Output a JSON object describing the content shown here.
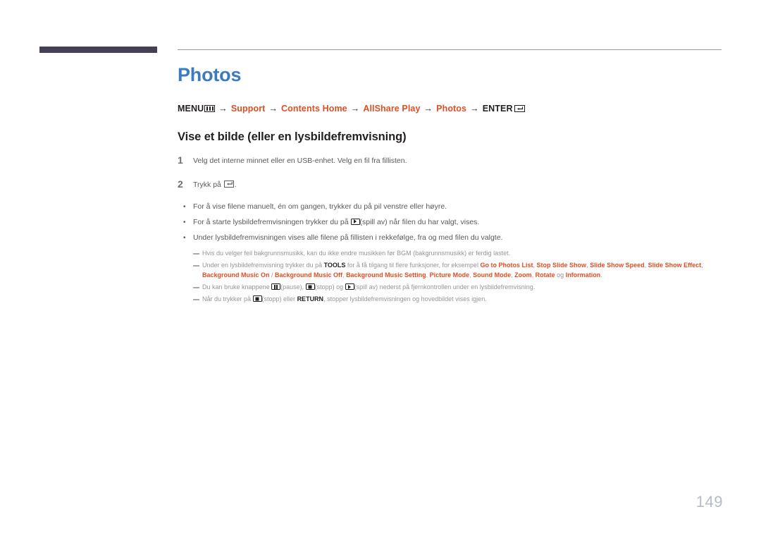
{
  "header": {
    "accent_bar_color": "#463e54",
    "rule_color": "#9a9a9a"
  },
  "doc": {
    "title": "Photos",
    "title_color": "#3b7cc1",
    "accent_color": "#de4f23"
  },
  "breadcrumb": {
    "arrow": "→",
    "items": [
      {
        "label": "MENU",
        "style": "plain",
        "icon": "menu-bars-icon"
      },
      {
        "label": "Support",
        "style": "accent",
        "icon": ""
      },
      {
        "label": "Contents Home",
        "style": "accent",
        "icon": ""
      },
      {
        "label": "AllShare Play",
        "style": "accent",
        "icon": ""
      },
      {
        "label": "Photos",
        "style": "accent",
        "icon": ""
      },
      {
        "label": "ENTER",
        "style": "plain",
        "icon": "enter-key-icon"
      }
    ]
  },
  "section": {
    "heading": "Vise et bilde (eller en lysbildefremvisning)"
  },
  "steps": [
    {
      "number": "1",
      "text": "Velg det interne minnet eller en USB-enhet. Velg en fil fra fillisten."
    },
    {
      "number": "2",
      "text_before": "Trykk på ",
      "icon": "enter-key-icon",
      "text_after": "."
    }
  ],
  "bullets": [
    {
      "marker": "•",
      "parts": [
        {
          "t": "text",
          "v": "For å vise filene manuelt, én om gangen, trykker du på pil venstre eller høyre."
        }
      ]
    },
    {
      "marker": "•",
      "parts": [
        {
          "t": "text",
          "v": "For å starte lysbildefremvisningen trykker du på "
        },
        {
          "t": "icon",
          "v": "play-key-icon"
        },
        {
          "t": "text",
          "v": "(spill av) når filen du har valgt, vises."
        }
      ]
    },
    {
      "marker": "•",
      "parts": [
        {
          "t": "text",
          "v": "Under lysbildefremvisningen vises alle filene på fillisten i rekkefølge, fra og med filen du valgte."
        }
      ]
    }
  ],
  "notes": [
    {
      "parts": [
        {
          "t": "text",
          "v": "Hvis du velger feil bakgrunnsmusikk, kan du ikke endre musikken før BGM (bakgrunnsmusikk) er ferdig lastet."
        }
      ]
    },
    {
      "parts": [
        {
          "t": "text",
          "v": "Under en lysbildefremvisning trykker du på "
        },
        {
          "t": "bold",
          "v": "TOOLS"
        },
        {
          "t": "text",
          "v": " for å få tilgang til flere funksjoner, for eksempel "
        },
        {
          "t": "accent",
          "v": "Go to Photos List"
        },
        {
          "t": "text",
          "v": ", "
        },
        {
          "t": "accent",
          "v": "Stop Slide Show"
        },
        {
          "t": "text",
          "v": ", "
        },
        {
          "t": "accent",
          "v": "Slide Show Speed"
        },
        {
          "t": "text",
          "v": ", "
        },
        {
          "t": "accent",
          "v": "Slide Show Effect"
        },
        {
          "t": "text",
          "v": ", "
        },
        {
          "t": "accent",
          "v": "Background Music On"
        },
        {
          "t": "text",
          "v": " / "
        },
        {
          "t": "accent",
          "v": "Background Music Off"
        },
        {
          "t": "text",
          "v": ", "
        },
        {
          "t": "accent",
          "v": "Background Music Setting"
        },
        {
          "t": "text",
          "v": ", "
        },
        {
          "t": "accent",
          "v": "Picture Mode"
        },
        {
          "t": "text",
          "v": ", "
        },
        {
          "t": "accent",
          "v": "Sound Mode"
        },
        {
          "t": "text",
          "v": ", "
        },
        {
          "t": "accent",
          "v": "Zoom"
        },
        {
          "t": "text",
          "v": ", "
        },
        {
          "t": "accent",
          "v": "Rotate"
        },
        {
          "t": "text",
          "v": " og "
        },
        {
          "t": "accent",
          "v": "Information"
        },
        {
          "t": "text",
          "v": "."
        }
      ]
    },
    {
      "parts": [
        {
          "t": "text",
          "v": "Du kan bruke knappene "
        },
        {
          "t": "icon",
          "v": "pause-key-icon"
        },
        {
          "t": "text",
          "v": "(pause), "
        },
        {
          "t": "icon",
          "v": "stop-key-icon"
        },
        {
          "t": "text",
          "v": "(stopp) og "
        },
        {
          "t": "icon",
          "v": "play-key-icon"
        },
        {
          "t": "text",
          "v": "(spill av) nederst på fjernkontrollen under en lysbildefremvisning."
        }
      ]
    },
    {
      "parts": [
        {
          "t": "text",
          "v": "Når du trykker på "
        },
        {
          "t": "icon",
          "v": "stop-key-icon"
        },
        {
          "t": "text",
          "v": "(stopp) eller "
        },
        {
          "t": "bold",
          "v": "RETURN"
        },
        {
          "t": "text",
          "v": ", stopper lysbildefremvisningen og hovedbildet vises igjen."
        }
      ]
    }
  ],
  "footer": {
    "page_number": "149"
  }
}
